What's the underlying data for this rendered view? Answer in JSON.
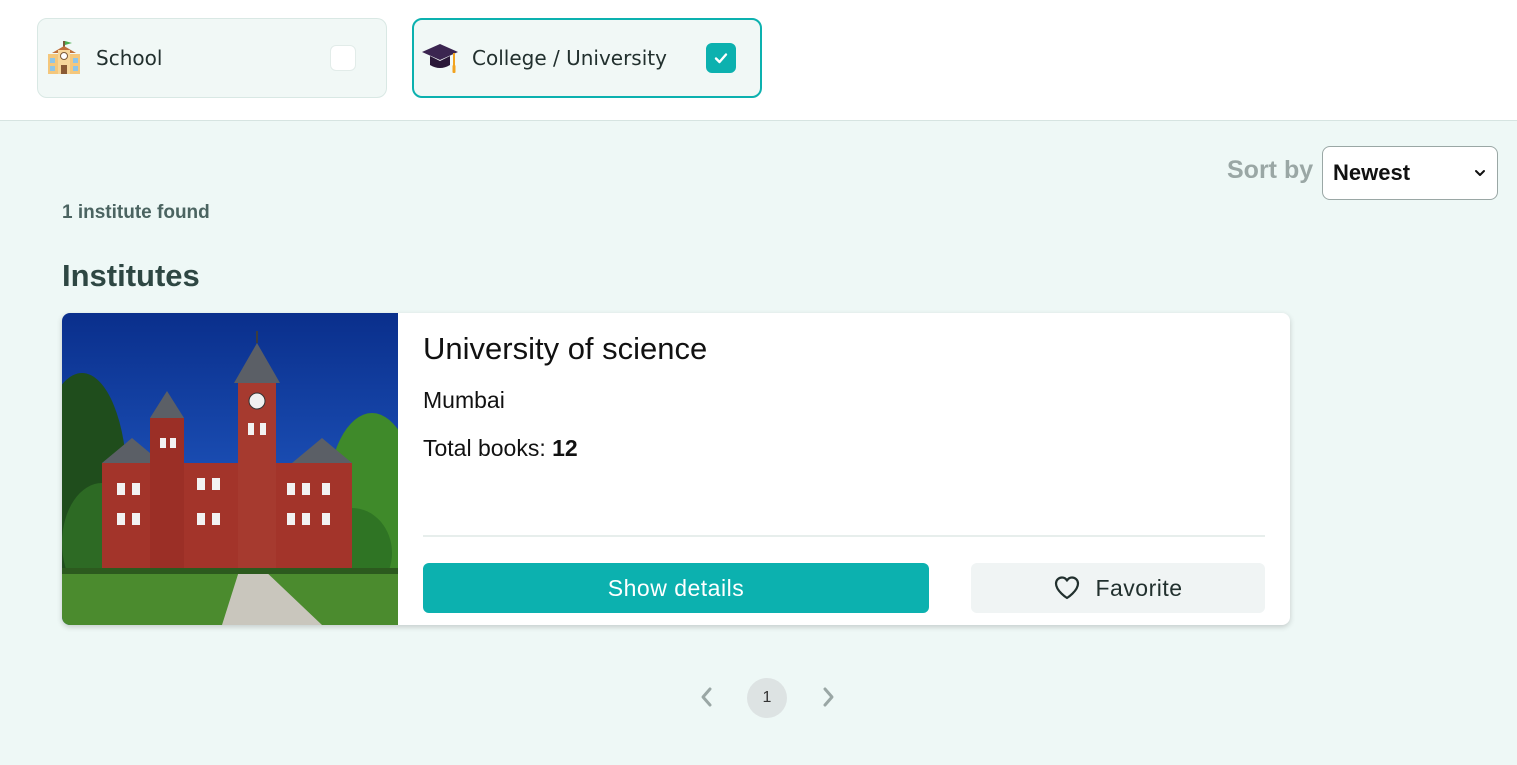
{
  "filters": [
    {
      "label": "School",
      "icon": "school-icon",
      "checked": false
    },
    {
      "label": "College / University",
      "icon": "graduation-cap-icon",
      "checked": true
    }
  ],
  "sort": {
    "label": "Sort by",
    "selected": "Newest"
  },
  "results": {
    "count_text": "1 institute found",
    "section_title": "Institutes"
  },
  "institute": {
    "name": "University of science",
    "city": "Mumbai",
    "books_label": "Total books: ",
    "books_value": "12",
    "image": "university-building-photo",
    "details_label": "Show details",
    "favorite_label": "Favorite"
  },
  "pagination": {
    "current": "1"
  },
  "colors": {
    "accent": "#0cb1af",
    "background": "#eef8f6"
  }
}
